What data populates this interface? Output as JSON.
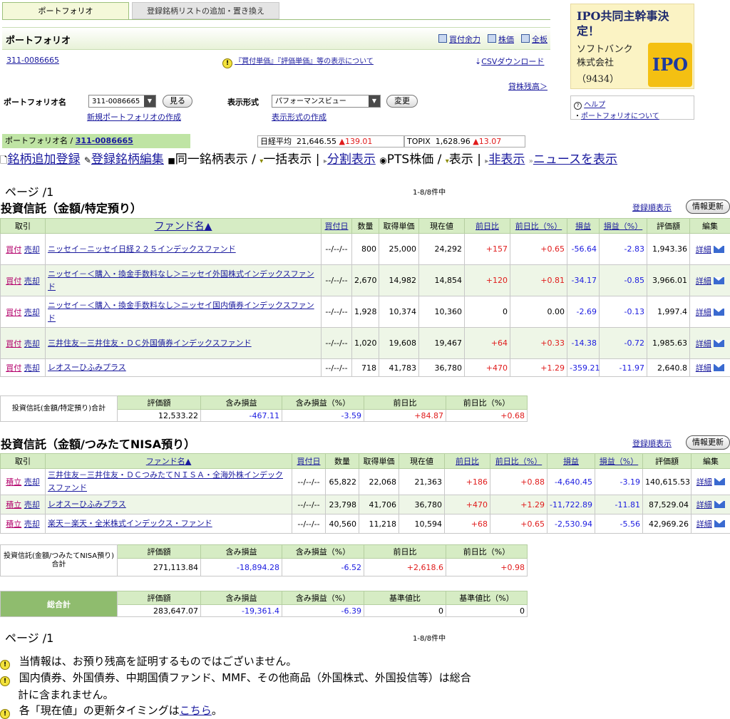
{
  "tabs": {
    "active": "ポートフォリオ",
    "inactive": "登録銘柄リストの追加・置き換え"
  },
  "header": {
    "title": "ポートフォリオ",
    "links": [
      "買付余力",
      "株価",
      "全板"
    ],
    "account": "311-0086665",
    "notice": "『買付単価』『評価単価』等の表示について",
    "csv": "CSVダウンロード",
    "balance": "貸株残高＞"
  },
  "controls": {
    "pf_label": "ポートフォリオ名",
    "pf_value": "311-0086665",
    "view_btn": "見る",
    "new_pf": "新規ポートフォリオの作成",
    "fmt_label": "表示形式",
    "fmt_value": "パフォーマンスビュー",
    "change_btn": "変更",
    "new_fmt": "表示形式の作成"
  },
  "pfbar": {
    "prefix": "ポートフォリオ名 / ",
    "name": "311-0086665"
  },
  "market": {
    "nikkei_label": "日経平均",
    "nikkei": "21,646.55",
    "nikkei_chg": "▲139.01",
    "topix_label": "TOPIX",
    "topix": "1,628.96",
    "topix_chg": "▲13.07"
  },
  "toolbar": {
    "add": "銘柄追加登録",
    "edit": "登録銘柄編集",
    "same": "同一銘柄表示",
    "bulk": "一括表示",
    "split": "分割表示",
    "pts": "PTS株価",
    "show": "表示",
    "hide": "非表示",
    "news": "ニュースを表示"
  },
  "page": {
    "label": "ページ /1",
    "count": "1-8/8件中"
  },
  "sections": {
    "s1": {
      "title": "投資信託（金額/特定預り）",
      "reg_order": "登録順表示",
      "refresh": "情報更新"
    },
    "s2": {
      "title": "投資信託（金額/つみたてNISA預り）",
      "reg_order": "登録順表示",
      "refresh": "情報更新"
    }
  },
  "columns": [
    "取引",
    "ファンド名▲",
    "買付日",
    "数量",
    "取得単価",
    "現在値",
    "前日比",
    "前日比（%）",
    "損益",
    "損益（%）",
    "評価額",
    "編集"
  ],
  "table1": [
    {
      "a": "買付",
      "b": "売却",
      "fund": "ニッセイ－ニッセイ日経２２５インデックスファンド",
      "date": "--/--/--",
      "qty": "800",
      "cost": "25,000",
      "price": "24,292",
      "chg": "+157",
      "chgp": "+0.65",
      "pl": "-56.64",
      "plp": "-2.83",
      "val": "1,943.36",
      "detail": "詳細"
    },
    {
      "a": "買付",
      "b": "売却",
      "fund": "ニッセイ－＜購入・換金手数料なし＞ニッセイ外国株式インデックスファンド",
      "date": "--/--/--",
      "qty": "2,670",
      "cost": "14,982",
      "price": "14,854",
      "chg": "+120",
      "chgp": "+0.81",
      "pl": "-34.17",
      "plp": "-0.85",
      "val": "3,966.01",
      "detail": "詳細"
    },
    {
      "a": "買付",
      "b": "売却",
      "fund": "ニッセイ－＜購入・換金手数料なし＞ニッセイ国内債券インデックスファンド",
      "date": "--/--/--",
      "qty": "1,928",
      "cost": "10,374",
      "price": "10,360",
      "chg": "0",
      "chgp": "0.00",
      "pl": "-2.69",
      "plp": "-0.13",
      "val": "1,997.4",
      "detail": "詳細"
    },
    {
      "a": "買付",
      "b": "売却",
      "fund": "三井住友－三井住友・ＤＣ外国債券インデックスファンド",
      "date": "--/--/--",
      "qty": "1,020",
      "cost": "19,608",
      "price": "19,467",
      "chg": "+64",
      "chgp": "+0.33",
      "pl": "-14.38",
      "plp": "-0.72",
      "val": "1,985.63",
      "detail": "詳細"
    },
    {
      "a": "買付",
      "b": "売却",
      "fund": "レオスーひふみプラス",
      "date": "--/--/--",
      "qty": "718",
      "cost": "41,783",
      "price": "36,780",
      "chg": "+470",
      "chgp": "+1.29",
      "pl": "-359.21",
      "plp": "-11.97",
      "val": "2,640.8",
      "detail": "詳細"
    }
  ],
  "sum1": {
    "label": "投資信託(金額/特定預り)合計",
    "heads": [
      "評価額",
      "含み損益",
      "含み損益（%）",
      "前日比",
      "前日比（%）"
    ],
    "vals": [
      "12,533.22",
      "-467.11",
      "-3.59",
      "+84.87",
      "+0.68"
    ]
  },
  "columns2": [
    "取引",
    "ファンド名▲",
    "買付日",
    "数量",
    "取得単価",
    "現在値",
    "前日比",
    "前日比（%）",
    "損益",
    "損益（%）",
    "評価額",
    "編集"
  ],
  "table2": [
    {
      "a": "積立",
      "b": "売却",
      "fund": "三井住友－三井住友・ＤＣつみたてＮＩＳＡ・全海外株インデックスファンド",
      "date": "--/--/--",
      "qty": "65,822",
      "cost": "22,068",
      "price": "21,363",
      "chg": "+186",
      "chgp": "+0.88",
      "pl": "-4,640.45",
      "plp": "-3.19",
      "val": "140,615.53",
      "detail": "詳細"
    },
    {
      "a": "積立",
      "b": "売却",
      "fund": "レオスーひふみプラス",
      "date": "--/--/--",
      "qty": "23,798",
      "cost": "41,706",
      "price": "36,780",
      "chg": "+470",
      "chgp": "+1.29",
      "pl": "-11,722.89",
      "plp": "-11.81",
      "val": "87,529.04",
      "detail": "詳細"
    },
    {
      "a": "積立",
      "b": "売却",
      "fund": "楽天－楽天・全米株式インデックス・ファンド",
      "date": "--/--/--",
      "qty": "40,560",
      "cost": "11,218",
      "price": "10,594",
      "chg": "+68",
      "chgp": "+0.65",
      "pl": "-2,530.94",
      "plp": "-5.56",
      "val": "42,969.26",
      "detail": "詳細"
    }
  ],
  "sum2": {
    "label": "投資信託(金額/つみたてNISA預り)合計",
    "heads": [
      "評価額",
      "含み損益",
      "含み損益（%）",
      "前日比",
      "前日比（%）"
    ],
    "vals": [
      "271,113.84",
      "-18,894.28",
      "-6.52",
      "+2,618.6",
      "+0.98"
    ]
  },
  "total": {
    "label": "総合計",
    "heads": [
      "評価額",
      "含み損益",
      "含み損益（%）",
      "基準値比",
      "基準値比（%）"
    ],
    "vals": [
      "283,647.07",
      "-19,361.4",
      "-6.39",
      "0",
      "0"
    ]
  },
  "notes": {
    "n1": "当情報は、お預り残高を証明するものではございません。",
    "n2a": "国内債券、外国債券、中期国債ファンド、MMF、その他商品（外国株式、外国投信等）は総合",
    "n2b": "計に含まれません。",
    "n3a": "各「現在値」の更新タイミングは",
    "n3link": "こちら",
    "n3b": "。"
  },
  "ad": {
    "title": "IPO共同主幹事決定！",
    "company": "ソフトバンク株式会社",
    "code": "（9434）",
    "badge": "IPO"
  },
  "help": {
    "help": "ヘルプ",
    "about": "ポートフォリオについて"
  },
  "colors": {
    "up": "#e01b1b",
    "down": "#1b1be0",
    "header_green": "#d6ecc4",
    "row_alt": "#eef6e7"
  }
}
